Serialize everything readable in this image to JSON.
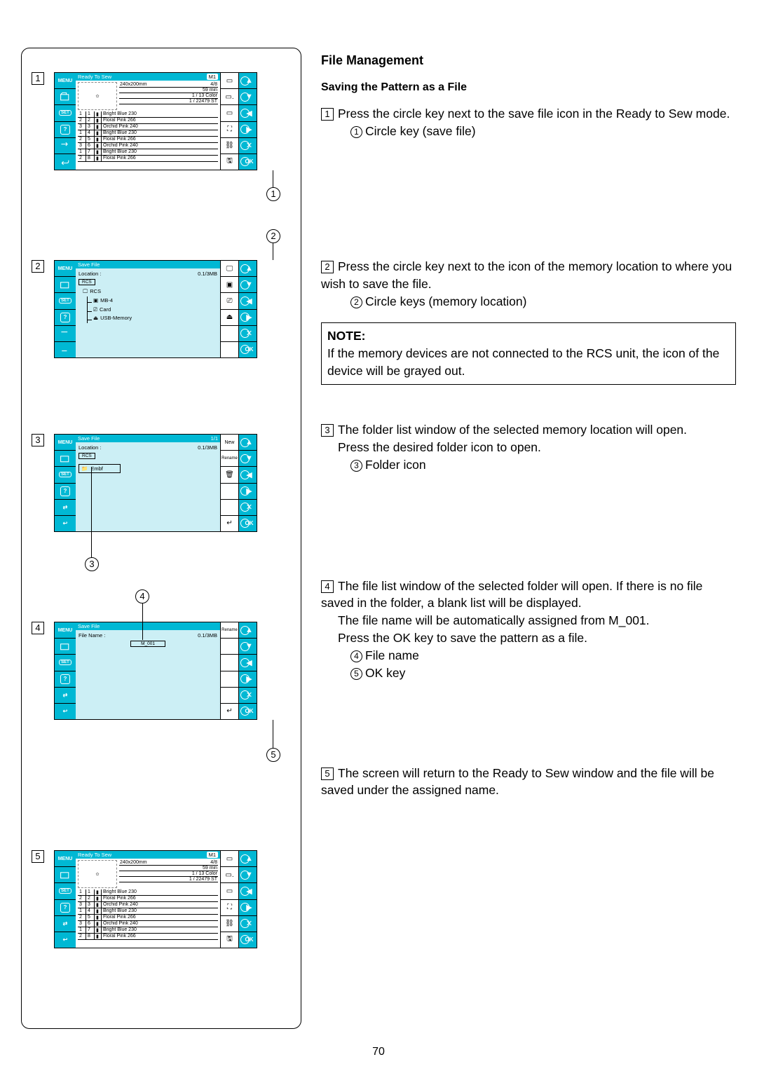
{
  "page_number": "70",
  "headings": {
    "h1": "File Management",
    "h2": "Saving the Pattern as a File"
  },
  "steps": {
    "s1": {
      "num": "1",
      "text": "Press the circle key next to the save file icon in the Ready to Sew mode.",
      "sub_num": "1",
      "sub_text": "Circle key (save file)"
    },
    "s2": {
      "num": "2",
      "text": "Press the circle key next to the icon of the memory location to where you wish to save the file.",
      "sub_num": "2",
      "sub_text": "Circle keys (memory location)"
    },
    "note": {
      "title": "NOTE:",
      "text": "If the memory devices are not connected to the RCS unit, the icon of the device will be grayed out."
    },
    "s3": {
      "num": "3",
      "text": "The folder list window of the selected memory location will open.",
      "text2": "Press the desired folder icon to open.",
      "sub_num": "3",
      "sub_text": "Folder icon"
    },
    "s4": {
      "num": "4",
      "text": "The file list window of the selected folder will open. If there is no file saved in the folder, a blank list will be displayed.",
      "text2": "The file name will be automatically assigned from M_001.",
      "text3": "Press the OK key to save the pattern as a file.",
      "sub_a_num": "4",
      "sub_a_text": "File name",
      "sub_b_num": "5",
      "sub_b_text": "OK key"
    },
    "s5": {
      "num": "5",
      "text": "The screen will return to the Ready to Sew window and the file will be saved under the assigned name."
    }
  },
  "leftbar": {
    "menu": "MENU",
    "set": "SET",
    "help": "?",
    "ok": "OK"
  },
  "ready_screen": {
    "title": "Ready To Sew",
    "mode": "M1",
    "page_ind": "4/8",
    "stats": {
      "size": "240x200mm",
      "time": "59 min",
      "colors": "1 / 13 Color",
      "stitches": "1 / 22479 ST"
    },
    "colors_list": [
      {
        "n": "1",
        "seq": "1",
        "name": "Bright Blue 230"
      },
      {
        "n": "2",
        "seq": "2",
        "name": "Floral Pink 266"
      },
      {
        "n": "3",
        "seq": "3",
        "name": "Orchid Pink 240"
      },
      {
        "n": "1",
        "seq": "4",
        "name": "Bright Blue 230"
      },
      {
        "n": "2",
        "seq": "5",
        "name": "Floral Pink 266"
      },
      {
        "n": "3",
        "seq": "6",
        "name": "Orchid Pink 240"
      },
      {
        "n": "1",
        "seq": "7",
        "name": "Bright Blue 230"
      },
      {
        "n": "2",
        "seq": "8",
        "name": "Floral Pink 266"
      }
    ]
  },
  "save_screen": {
    "title": "Save File",
    "loc_label": "Location :",
    "mem": "0.1/3MB",
    "rcs": "RCS",
    "tree": {
      "mb4": "MB-4",
      "card": "Card",
      "usb": "USB-Memory"
    }
  },
  "folder_screen": {
    "title": "Save File",
    "page": "1/1",
    "loc_label": "Location :",
    "mem": "0.1/3MB",
    "rcs": "RCS",
    "folder": "Embf",
    "side": {
      "new": "New",
      "rename": "Rename"
    }
  },
  "file_screen": {
    "title": "Save File",
    "name_label": "File Name :",
    "mem": "0.1/3MB",
    "filename": "M_001",
    "side": {
      "rename": "Rename"
    }
  },
  "callouts": {
    "c1": "1",
    "c2": "2",
    "c3": "3",
    "c4": "4",
    "c5": "5"
  }
}
